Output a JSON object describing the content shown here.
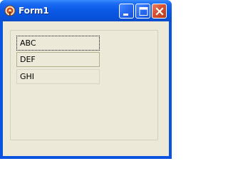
{
  "window": {
    "title": "Form1",
    "controls": {
      "minimize": "minimize-icon",
      "maximize": "maximize-icon",
      "close": "close-icon"
    },
    "app_icon": "delphi-app-icon"
  },
  "list": {
    "items": [
      {
        "label": "ABC",
        "state": "focused"
      },
      {
        "label": "DEF",
        "state": "hover"
      },
      {
        "label": "GHI",
        "state": "normal"
      }
    ]
  },
  "colors": {
    "titlebar": "#0A58E4",
    "client_background": "#ECE9D8",
    "close_button": "#D6502E"
  }
}
